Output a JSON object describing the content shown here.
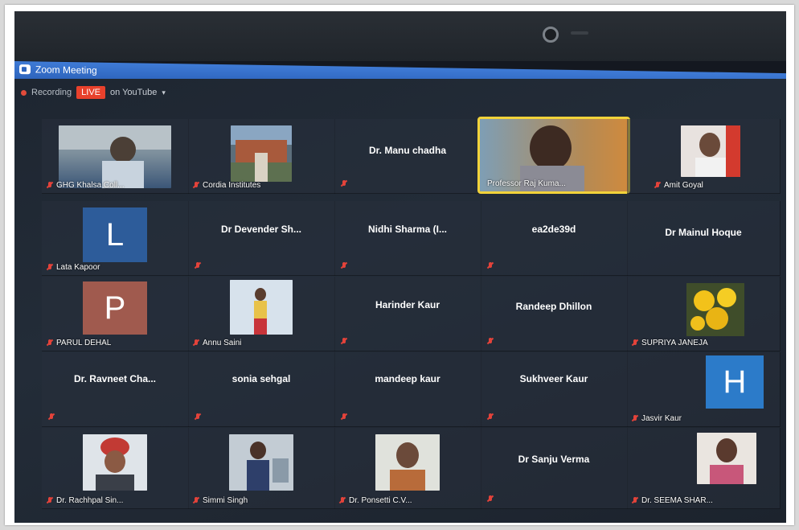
{
  "window": {
    "title": "Zoom Meeting"
  },
  "status": {
    "recording": "Recording",
    "live": "LIVE",
    "platform": "on YouTube"
  },
  "colors": {
    "accent": "#2d64bd",
    "live": "#e8412c",
    "active_speaker": "#f2d33a",
    "muted": "#e4433a"
  },
  "participants": [
    {
      "name": "GHG Khalsa Coll...",
      "muted": true,
      "type": "video"
    },
    {
      "name": "Cordia Institutes",
      "muted": true,
      "type": "video"
    },
    {
      "name": "Dr. Manu chadha",
      "muted": true,
      "type": "name"
    },
    {
      "name": "Professor Raj Kuma...",
      "muted": false,
      "type": "video",
      "active": true
    },
    {
      "name": "Amit Goyal",
      "muted": true,
      "type": "video"
    },
    {
      "name": "Lata Kapoor",
      "muted": true,
      "type": "letter",
      "letter": "L"
    },
    {
      "name": "Dr Devender Sh...",
      "muted": true,
      "type": "name"
    },
    {
      "name": "Nidhi Sharma (I...",
      "muted": true,
      "type": "name"
    },
    {
      "name": "ea2de39d",
      "muted": true,
      "type": "name"
    },
    {
      "name": "Dr Mainul Hoque",
      "muted": false,
      "type": "name"
    },
    {
      "name": "PARUL DEHAL",
      "muted": true,
      "type": "letter",
      "letter": "P"
    },
    {
      "name": "Annu Saini",
      "muted": true,
      "type": "video"
    },
    {
      "name": "Harinder Kaur",
      "muted": true,
      "type": "name"
    },
    {
      "name": "Randeep Dhillon",
      "muted": true,
      "type": "name"
    },
    {
      "name": "SUPRIYA JANEJA",
      "muted": true,
      "type": "video"
    },
    {
      "name": "Dr. Ravneet Cha...",
      "muted": true,
      "type": "name"
    },
    {
      "name": "sonia sehgal",
      "muted": true,
      "type": "name"
    },
    {
      "name": "mandeep kaur",
      "muted": true,
      "type": "name"
    },
    {
      "name": "Sukhveer Kaur",
      "muted": true,
      "type": "name"
    },
    {
      "name": "Jasvir Kaur",
      "muted": true,
      "type": "letter",
      "letter": "H"
    },
    {
      "name": "Dr. Rachhpal Sin...",
      "muted": true,
      "type": "video"
    },
    {
      "name": "Simmi Singh",
      "muted": true,
      "type": "video"
    },
    {
      "name": "Dr. Ponsetti C.V...",
      "muted": true,
      "type": "video"
    },
    {
      "name": "Dr Sanju Verma",
      "muted": true,
      "type": "name"
    },
    {
      "name": "Dr. SEEMA SHAR...",
      "muted": true,
      "type": "video"
    }
  ]
}
